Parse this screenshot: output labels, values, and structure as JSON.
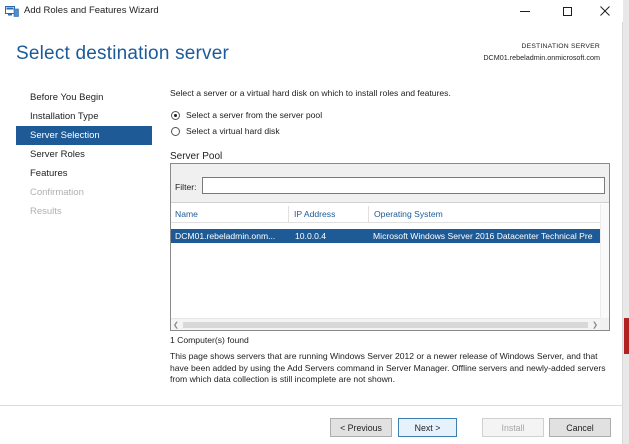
{
  "window": {
    "title": "Add Roles and Features Wizard",
    "icon": "server-manager-icon"
  },
  "header": {
    "title": "Select destination server",
    "destination_label": "DESTINATION SERVER",
    "destination_server": "DCM01.rebeladmin.onmicrosoft.com"
  },
  "nav": {
    "items": [
      {
        "label": "Before You Begin",
        "state": "normal"
      },
      {
        "label": "Installation Type",
        "state": "normal"
      },
      {
        "label": "Server Selection",
        "state": "active"
      },
      {
        "label": "Server Roles",
        "state": "normal"
      },
      {
        "label": "Features",
        "state": "normal"
      },
      {
        "label": "Confirmation",
        "state": "disabled"
      },
      {
        "label": "Results",
        "state": "disabled"
      }
    ]
  },
  "main": {
    "intro": "Select a server or a virtual hard disk on which to install roles and features.",
    "options": [
      {
        "label": "Select a server from the server pool",
        "checked": true
      },
      {
        "label": "Select a virtual hard disk",
        "checked": false
      }
    ],
    "pool_label": "Server Pool",
    "filter_label": "Filter:",
    "filter_value": "",
    "columns": [
      "Name",
      "IP Address",
      "Operating System"
    ],
    "rows": [
      {
        "name": "DCM01.rebeladmin.onm...",
        "ip": "10.0.0.4",
        "os": "Microsoft Windows Server 2016 Datacenter Technical Pre",
        "selected": true
      }
    ],
    "count_text": "1 Computer(s) found",
    "description": "This page shows servers that are running Windows Server 2012 or a newer release of Windows Server, and that have been added by using the Add Servers command in Server Manager. Offline servers and newly-added servers from which data collection is still incomplete are not shown."
  },
  "footer": {
    "previous": "< Previous",
    "next": "Next >",
    "install": "Install",
    "cancel": "Cancel"
  },
  "colors": {
    "accent": "#1e5b96",
    "title": "#1c5a98"
  }
}
